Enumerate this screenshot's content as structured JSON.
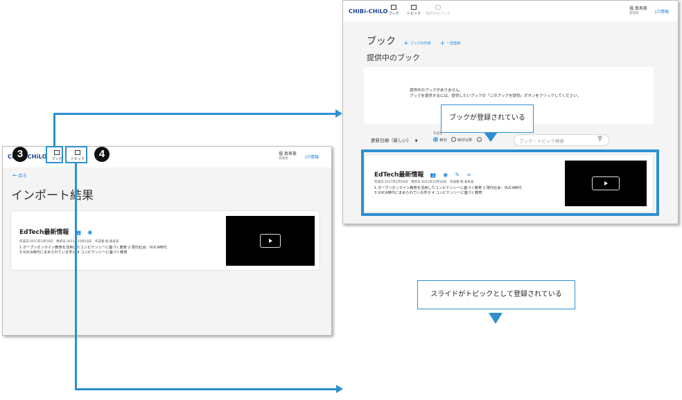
{
  "import_screen": {
    "logo": "CHiBi-CHiLO",
    "nav": {
      "book": "ブック",
      "topic": "トピック"
    },
    "user": {
      "name": "堀 真寿美",
      "role": "管理者"
    },
    "lti_link": "LTI情報",
    "back": "戻る",
    "title": "インポート結果",
    "book_card": {
      "title": "EdTech最新情報",
      "meta": "作成日:2017年2月16日　更新日:2021年10月18日　作成者:堀 真寿美",
      "desc_line1": "1 オープンオンライン教育を活用したコンピテンシーに基づく教育 2 現代社会：VUCA時代",
      "desc_line2": "3 VUCA時代にまめられている学び 4 コンピテンシーに基づく教育"
    }
  },
  "book_screen": {
    "logo": "CHiBi-CHiLO",
    "nav": {
      "book": "ブック",
      "topic": "トピック",
      "provided": "提供中のブック"
    },
    "user": {
      "name": "堀 真寿美",
      "role": "管理者"
    },
    "lti_link": "LTI情報",
    "title": "ブック",
    "create_link": "ブックの作成",
    "bulk_link": "一括登録",
    "section_title": "提供中のブック",
    "empty_line1": "提供中のブックがありません。",
    "empty_line2": "ブックを提供するには、提供したいブックの『このブックを提供』ボタンをクリックしてください。",
    "sort_label": "更新日順（新しい）",
    "creator_filter_label": "作成者",
    "radio_self": "自分",
    "radio_others": "自分以外",
    "search_placeholder": "ブック・トピック検索",
    "book_card": {
      "title": "EdTech最新情報",
      "meta": "作成日:2017年2月16日　更新日:2021年10月18日　作成者:堀 真寿美",
      "desc_line1": "1 オープンオンライン教育を活用したコンピテンシーに基づく教育 2 現代社会：VUCA時代",
      "desc_line2": "3 VUCA時代にまめられている学び 4 コンピテンシーに基づく教育"
    }
  },
  "annotations": {
    "step3": "3",
    "step4": "4",
    "callout_book": "ブックが登録されている",
    "callout_slide": "スライドがトピックとして登録されている"
  },
  "colors": {
    "accent": "#2c8fd0",
    "link": "#1e88e5",
    "logo": "#1a3f8f"
  },
  "icons": [
    "book-icon",
    "topic-icon",
    "link-icon",
    "arrow-left-icon",
    "people-icon",
    "eye-icon",
    "pencil-icon",
    "search-icon",
    "play-icon",
    "plus-icon",
    "chevron-down-icon"
  ]
}
